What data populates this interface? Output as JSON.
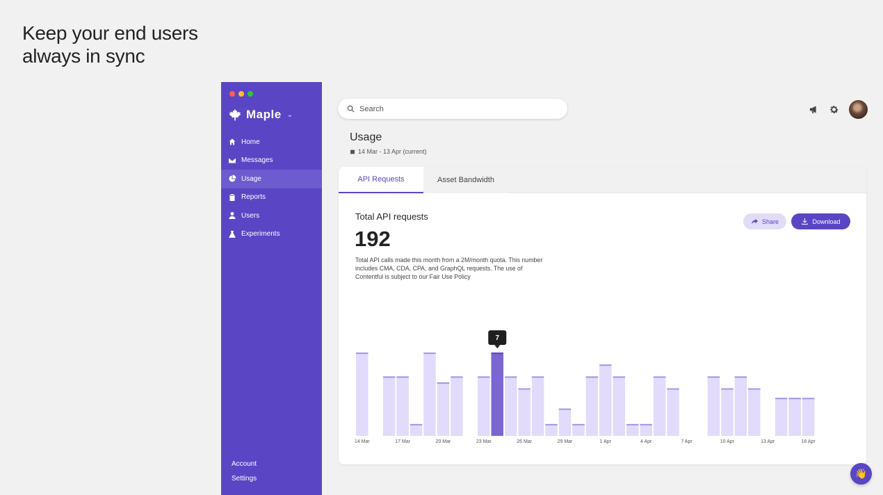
{
  "hero": {
    "line1": "Keep your end users",
    "line2": "always in sync"
  },
  "app": {
    "name": "Maple",
    "chevron": "⌄"
  },
  "sidebar": {
    "items": [
      {
        "label": "Home",
        "icon": "home-icon"
      },
      {
        "label": "Messages",
        "icon": "envelope-icon"
      },
      {
        "label": "Usage",
        "icon": "pie-chart-icon",
        "active": true
      },
      {
        "label": "Reports",
        "icon": "clipboard-icon"
      },
      {
        "label": "Users",
        "icon": "user-icon"
      },
      {
        "label": "Experiments",
        "icon": "flask-icon"
      }
    ],
    "bottom": {
      "account": "Account",
      "settings": "Settings"
    }
  },
  "search": {
    "placeholder": "Search"
  },
  "page": {
    "title": "Usage",
    "date_range": "14 Mar - 13 Apr (current)"
  },
  "tabs": {
    "api": "API Requests",
    "bandwidth": "Asset Bandwidth"
  },
  "metric": {
    "label": "Total API requests",
    "value": "192",
    "description": "Total API calls made this month from a 2M/month quota. This number includes CMA, CDA, CPA, and GraphQL requests. The use of Contentful is subject to our Fair Use Policy"
  },
  "actions": {
    "share": "Share",
    "download": "Download"
  },
  "colors": {
    "accent": "#5a46c4",
    "bar": "#e2dbfb",
    "bar_highlight": "#7b66d2",
    "bar_top": "#a595e6"
  },
  "chart_data": {
    "type": "bar",
    "tooltip": {
      "label": "7",
      "index": 10
    },
    "ylim": [
      0,
      8
    ],
    "values": [
      7,
      0,
      5,
      5,
      1,
      7,
      4.5,
      5,
      0,
      5,
      7,
      5,
      4,
      5,
      1,
      2.3,
      1,
      5,
      6,
      5,
      1,
      1,
      5,
      4,
      0,
      0,
      5,
      4,
      5,
      4,
      0,
      3.2,
      3.2,
      3.2
    ],
    "highlight_index": 10,
    "x_ticks": [
      {
        "index": 0,
        "label": "14 Mar"
      },
      {
        "index": 3,
        "label": "17 Mar"
      },
      {
        "index": 6,
        "label": "20 Mar"
      },
      {
        "index": 9,
        "label": "23 Mar"
      },
      {
        "index": 12,
        "label": "26 Mar"
      },
      {
        "index": 15,
        "label": "29 Mar"
      },
      {
        "index": 18,
        "label": "1 Apr"
      },
      {
        "index": 21,
        "label": "4 Apr"
      },
      {
        "index": 24,
        "label": "7 Apr"
      },
      {
        "index": 27,
        "label": "10 Apr"
      },
      {
        "index": 30,
        "label": "13 Apr"
      },
      {
        "index": 33,
        "label": "16 Apr"
      }
    ],
    "grid": false,
    "legend": "none"
  },
  "help": {
    "emoji": "👋"
  }
}
